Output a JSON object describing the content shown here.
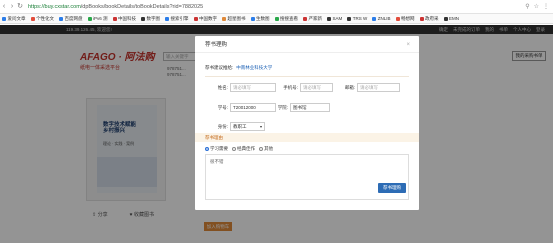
{
  "browser": {
    "url_host": "https://buy.cxstar.com",
    "url_path": "/dpBooks/bookDetails/toBookDetails?rid=7882025",
    "bookmarks": [
      {
        "label": "爱问文章",
        "color": "#2b7de9"
      },
      {
        "label": "个性化文",
        "color": "#e24c3b"
      },
      {
        "label": "百度网盘",
        "color": "#2b7de9"
      },
      {
        "label": "iPv6 测",
        "color": "#2aa84a"
      },
      {
        "label": "中国科技",
        "color": "#c33"
      },
      {
        "label": "数字图",
        "color": "#333"
      },
      {
        "label": "搜索引擎",
        "color": "#2b7de9"
      },
      {
        "label": "中国数字",
        "color": "#c33"
      },
      {
        "label": "超星图书",
        "color": "#e08a3a"
      },
      {
        "label": "生数图",
        "color": "#2b7de9"
      },
      {
        "label": "搜搜查看",
        "color": "#2aa84a"
      },
      {
        "label": "严家新",
        "color": "#c33"
      },
      {
        "label": "SAM",
        "color": "#333"
      },
      {
        "label": "TRS W",
        "color": "#333"
      },
      {
        "label": "ZNLIB",
        "color": "#2b7de9"
      },
      {
        "label": "畅想网",
        "color": "#e24c3b"
      },
      {
        "label": "政府采",
        "color": "#c33"
      },
      {
        "label": "EMN",
        "color": "#333"
      }
    ]
  },
  "site": {
    "top_ip": "119.39.126.45, 欢迎您!",
    "top_links": [
      "确定",
      "未完成的订单",
      "我的",
      "书单",
      "个人中心",
      "登录"
    ],
    "brand": "AFAGO · 阿法购",
    "slogan": "纸电一体采选平台",
    "search_placeholder": "输入关键字",
    "isbn_lines": [
      "978751...",
      "978751..."
    ],
    "my_shelf": "我的采购书单",
    "book_title_line1": "数字技术赋能",
    "book_title_line2": "乡村振兴",
    "book_subtitle": "理论 · 实践 · 案例",
    "share_label": "分享",
    "favorite_label": "收藏图书",
    "buy_label": "加入购物车"
  },
  "modal": {
    "title": "荐书理购",
    "recipient_label": "荐书建议推给:",
    "recipient_school": "中南林业科技大学",
    "fields": {
      "name_label": "姓名:",
      "name_placeholder": "请必填写",
      "phone_label": "手机号:",
      "phone_placeholder": "请必填写",
      "email_label": "邮箱:",
      "email_placeholder": "请必填写",
      "id_label": "学号:",
      "id_value": "T20012000",
      "college_label": "学院:",
      "college_value": "图书馆",
      "role_label": "身份:",
      "role_value": "教职工"
    },
    "reason_title": "荐书理由",
    "reasons": [
      {
        "label": "学习需要",
        "checked": true
      },
      {
        "label": "经典佳作",
        "checked": false
      },
      {
        "label": "其他",
        "checked": false
      }
    ],
    "comment_value": "很不错",
    "submit_label": "荐书理购"
  },
  "colors": {
    "brand_red": "#c4312a",
    "submit_blue": "#2d6cb5",
    "buy_orange": "#e08a3a"
  }
}
